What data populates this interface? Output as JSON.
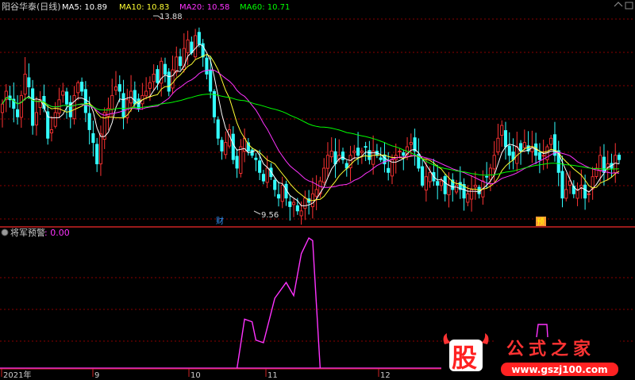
{
  "header": {
    "stock_label": "阳谷华泰(日线)",
    "ma_legend": [
      {
        "label": "MA5: 10.89",
        "color": "#ffffff"
      },
      {
        "label": "MA10: 10.83",
        "color": "#ffff33"
      },
      {
        "label": "MA20: 10.58",
        "color": "#ff33ff"
      },
      {
        "label": "MA60: 10.71",
        "color": "#00ff00"
      }
    ]
  },
  "indicator": {
    "name": "将军预警",
    "value_label": ": 0.00",
    "name_color": "#cccccc",
    "value_color": "#ff33ff"
  },
  "markers": {
    "high_label": "13.88",
    "low_label": "9.56",
    "event_fin": "财",
    "event_forecast": "预"
  },
  "x_axis": {
    "labels": [
      "2021年",
      "9",
      "10",
      "11",
      "12"
    ]
  },
  "watermark": {
    "logo_char": "股",
    "site_name": "公式之家",
    "url": "www.gszj100.com"
  },
  "colors": {
    "up": "#ff3333",
    "down": "#33ffff",
    "ma5": "#ffffff",
    "ma10": "#ffff33",
    "ma20": "#ff33ff",
    "ma60": "#00ff00",
    "grid": "#8b0000",
    "separator": "#ff3333",
    "indicator_line": "#ff33ff"
  },
  "chart_data": [
    {
      "type": "candlestick",
      "title": "阳谷华泰(日线)",
      "ylim": [
        9.3,
        14.2
      ],
      "date_ticks": [
        "2021年",
        "9",
        "10",
        "11",
        "12"
      ],
      "high": 13.88,
      "low": 9.56,
      "series": [
        {
          "name": "MA5",
          "last": 10.89
        },
        {
          "name": "MA10",
          "last": 10.83
        },
        {
          "name": "MA20",
          "last": 10.58
        },
        {
          "name": "MA60",
          "last": 10.71
        }
      ],
      "close_approx": [
        12.1,
        12.4,
        12.2,
        12.0,
        11.8,
        12.3,
        12.8,
        12.5,
        11.6,
        11.9,
        12.2,
        12.0,
        11.3,
        11.5,
        11.9,
        12.2,
        12.4,
        12.1,
        11.8,
        12.3,
        12.6,
        12.4,
        11.9,
        11.5,
        11.2,
        10.7,
        11.4,
        11.9,
        12.0,
        12.3,
        12.5,
        12.4,
        11.8,
        12.2,
        12.4,
        12.1,
        12.0,
        12.3,
        12.4,
        12.6,
        12.8,
        12.6,
        13.1,
        12.8,
        12.4,
        12.9,
        13.2,
        13.0,
        13.4,
        13.6,
        13.3,
        13.7,
        13.5,
        13.2,
        12.8,
        12.4,
        11.8,
        11.3,
        11.0,
        11.2,
        11.5,
        10.8,
        10.6,
        11.1,
        11.3,
        11.0,
        10.9,
        10.8,
        10.5,
        10.3,
        10.6,
        10.4,
        10.1,
        9.9,
        10.2,
        9.9,
        9.7,
        9.8,
        9.6,
        9.6,
        9.9,
        9.8,
        10.0,
        10.1,
        10.3,
        10.6,
        10.9,
        11.0,
        10.7,
        10.9,
        10.8,
        10.6,
        10.9,
        11.0,
        10.9,
        11.0,
        11.1,
        10.8,
        11.0,
        10.9,
        10.8,
        10.7,
        10.5,
        10.8,
        10.9,
        11.0,
        10.9,
        11.1,
        11.2,
        11.0,
        10.6,
        10.2,
        10.4,
        10.5,
        10.3,
        10.2,
        10.3,
        10.0,
        10.2,
        10.1,
        10.2,
        10.1,
        9.9,
        10.0,
        10.1,
        10.2,
        10.0,
        10.3,
        10.4,
        10.6,
        10.9,
        11.3,
        11.6,
        11.1,
        10.9,
        10.8,
        11.1,
        11.0,
        11.2,
        11.0,
        11.1,
        10.9,
        10.8,
        10.9,
        11.1,
        11.3,
        10.9,
        10.5,
        9.9,
        10.1,
        10.3,
        10.0,
        10.1,
        10.2,
        9.9,
        10.0,
        10.4,
        10.6,
        10.9,
        10.5,
        10.7,
        10.6,
        10.9,
        10.8
      ],
      "note": "close_approx values are estimated from the candlestick bodies"
    },
    {
      "type": "line",
      "title": "将军预警",
      "ylim": [
        0,
        10
      ],
      "x": [
        0,
        68,
        132,
        138,
        143,
        148,
        153,
        158,
        162,
        166,
        170,
        171,
        172,
        180,
        185,
        190,
        195,
        200,
        201,
        305,
        315,
        324,
        325,
        330
      ],
      "values": [
        0,
        0,
        0,
        6.4,
        7.2,
        9.6,
        9.8,
        9.4,
        9.6,
        9.7,
        9.8,
        10.0,
        9.8,
        0,
        0,
        0,
        0,
        0,
        0,
        0,
        0,
        0,
        0,
        0
      ]
    }
  ]
}
